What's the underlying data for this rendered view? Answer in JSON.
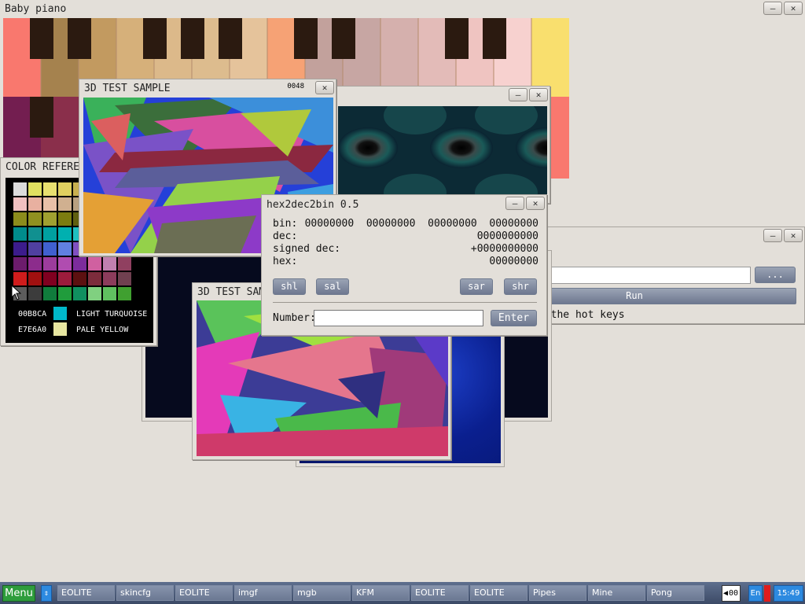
{
  "colors": {
    "desktop": "#e3dfd9",
    "accent": "#3c4a66",
    "menu_green": "#2e9d3c"
  },
  "piano": {
    "title": "Baby piano"
  },
  "samples": {
    "title1": "3D TEST SAMPLE",
    "title2": "3D TEST SAMPLE",
    "fps": "0048"
  },
  "colorref": {
    "title": "COLOR REFERE",
    "sel1_hex": "00B8CA",
    "sel1_name": "LIGHT TURQUOISE",
    "sel2_hex": "E7E6A0",
    "sel2_name": "PALE YELLOW"
  },
  "hex": {
    "title": "hex2dec2bin 0.5",
    "bin_label": "bin:",
    "bin_value": "00000000  00000000  00000000  00000000",
    "dec_label": "dec:",
    "dec_value": "0000000000",
    "sdec_label": "signed dec:",
    "sdec_value": "+0000000000",
    "hex_label": "hex:",
    "hex_value": "00000000",
    "shl": "shl",
    "sal": "sal",
    "sar": "sar",
    "shr": "shr",
    "number_label": "Number:",
    "number_value": "",
    "enter": "Enter"
  },
  "runbox": {
    "browse": "...",
    "run": "Run",
    "hint": "t the hot keys",
    "input_value": ""
  },
  "taskbar": {
    "menu": "Menu",
    "tasks": [
      "EOLITE",
      "skincfg",
      "EOLITE",
      "imgf",
      "mgb",
      "KFM",
      "EOLITE",
      "EOLITE",
      "Pipes",
      "Mine",
      "Pong"
    ],
    "pager": "00",
    "lang": "En",
    "clock": "15:49"
  }
}
